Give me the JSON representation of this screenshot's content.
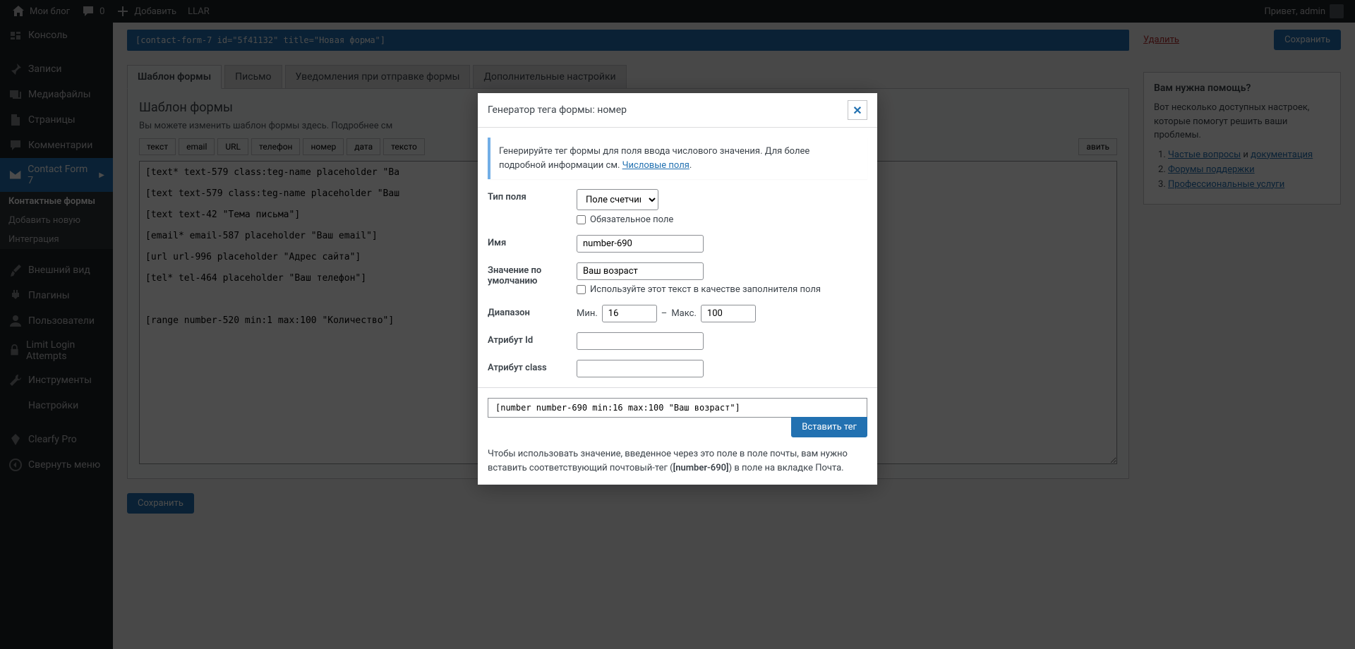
{
  "toolbar": {
    "site": "Мои блог",
    "comments": "0",
    "add": "Добавить",
    "llar": "LLAR",
    "greeting": "Привет, admin"
  },
  "sidebar": {
    "console": "Консоль",
    "posts": "Записи",
    "media": "Медиафайлы",
    "pages": "Страницы",
    "comments": "Комментарии",
    "cf7": "Contact Form 7",
    "cf7_forms": "Контактные формы",
    "cf7_add": "Добавить новую",
    "cf7_integration": "Интеграция",
    "appearance": "Внешний вид",
    "plugins": "Плагины",
    "users": "Пользователи",
    "lla": "Limit Login Attempts",
    "tools": "Инструменты",
    "settings": "Настройки",
    "clearfy": "Clearfy Pro",
    "collapse": "Свернуть меню"
  },
  "shortcode": "[contact-form-7 id=\"5f41132\" title=\"Новая форма\"]",
  "actions": {
    "delete": "Удалить",
    "save": "Сохранить"
  },
  "tabs": {
    "form": "Шаблон формы",
    "mail": "Письмо",
    "messages": "Уведомления при отправке формы",
    "additional": "Дополнительные настройки"
  },
  "panel": {
    "title": "Шаблон формы",
    "desc": "Вы можете изменить шаблон формы здесь. Подробнее см"
  },
  "tags": {
    "text": "текст",
    "email": "email",
    "url": "URL",
    "tel": "телефон",
    "number": "номер",
    "date": "дата",
    "textarea": "тексто",
    "insert": "авить"
  },
  "form_content": "[text* text-579 class:teg-name placeholder \"Ва\n\n[text text-579 class:teg-name placeholder \"Ваш\n\n[text text-42 \"Тема письма\"]\n\n[email* email-587 placeholder \"Ваш email\"]\n\n[url url-996 placeholder \"Адрес сайта\"]\n\n[tel* tel-464 placeholder \"Ваш телефон\"]\n\n\n\n[range number-520 min:1 max:100 \"Количество\"]",
  "help": {
    "title": "Вам нужна помощь?",
    "text": "Вот несколько доступных настроек, которые помогут решить ваши проблемы.",
    "link1": "Частые вопросы",
    "and": " и ",
    "link1b": "документация",
    "link2": "Форумы поддержки",
    "link3": "Профессиональные услуги"
  },
  "modal": {
    "title": "Генератор тега формы: номер",
    "info": "Генерируйте тег формы для поля ввода числового значения. Для более подробной информации см. ",
    "info_link": "Числовые поля",
    "field_type": "Тип поля",
    "field_type_value": "Поле счетчика",
    "required": "Обязательное поле",
    "name": "Имя",
    "name_value": "number-690",
    "default": "Значение по умолчанию",
    "default_value": "Ваш возраст",
    "placeholder": "Используйте этот текст в качестве заполнителя поля",
    "range": "Диапазон",
    "min": "Мин.",
    "min_value": "16",
    "max": "Макс.",
    "max_value": "100",
    "dash": "–",
    "id_attr": "Атрибут Id",
    "class_attr": "Атрибут class",
    "output": "[number number-690 min:16 max:100 \"Ваш возраст\"]",
    "insert": "Вставить тег",
    "note1": "Чтобы использовать значение, введенное через это поле в поле почты, вам нужно вставить соответствующий почтовый-тег (",
    "note_tag": "[number-690]",
    "note2": ") в поле на вкладке Почта."
  }
}
